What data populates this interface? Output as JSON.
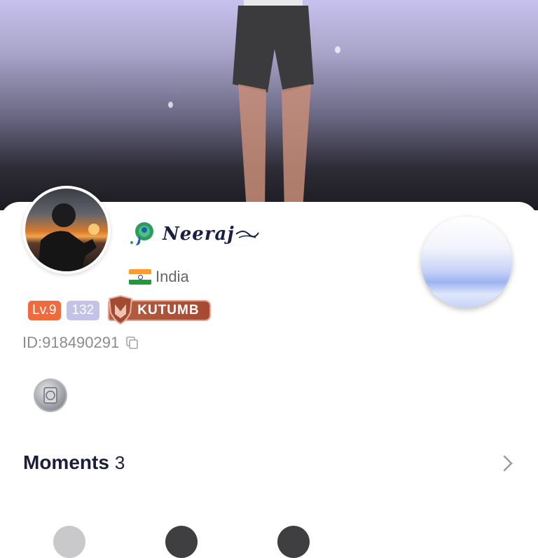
{
  "profile": {
    "name": "Neeraj",
    "country": "India",
    "level": "Lv.9",
    "level_number": "132",
    "family_badge": "KUTUMB",
    "id": "ID:918490291"
  },
  "moments": {
    "title": "Moments",
    "count": "3"
  },
  "colors": {
    "level_badge": "#ef6a3c",
    "number_badge": "#c2c3e6",
    "family_badge": "#a64a32",
    "title_text": "#1b1e3a"
  },
  "icons": {
    "copy": "copy-icon",
    "chevron": "chevron-right-icon",
    "medal": "medal-badge-icon",
    "peacock": "peacock-icon",
    "flag": "india-flag-icon"
  }
}
